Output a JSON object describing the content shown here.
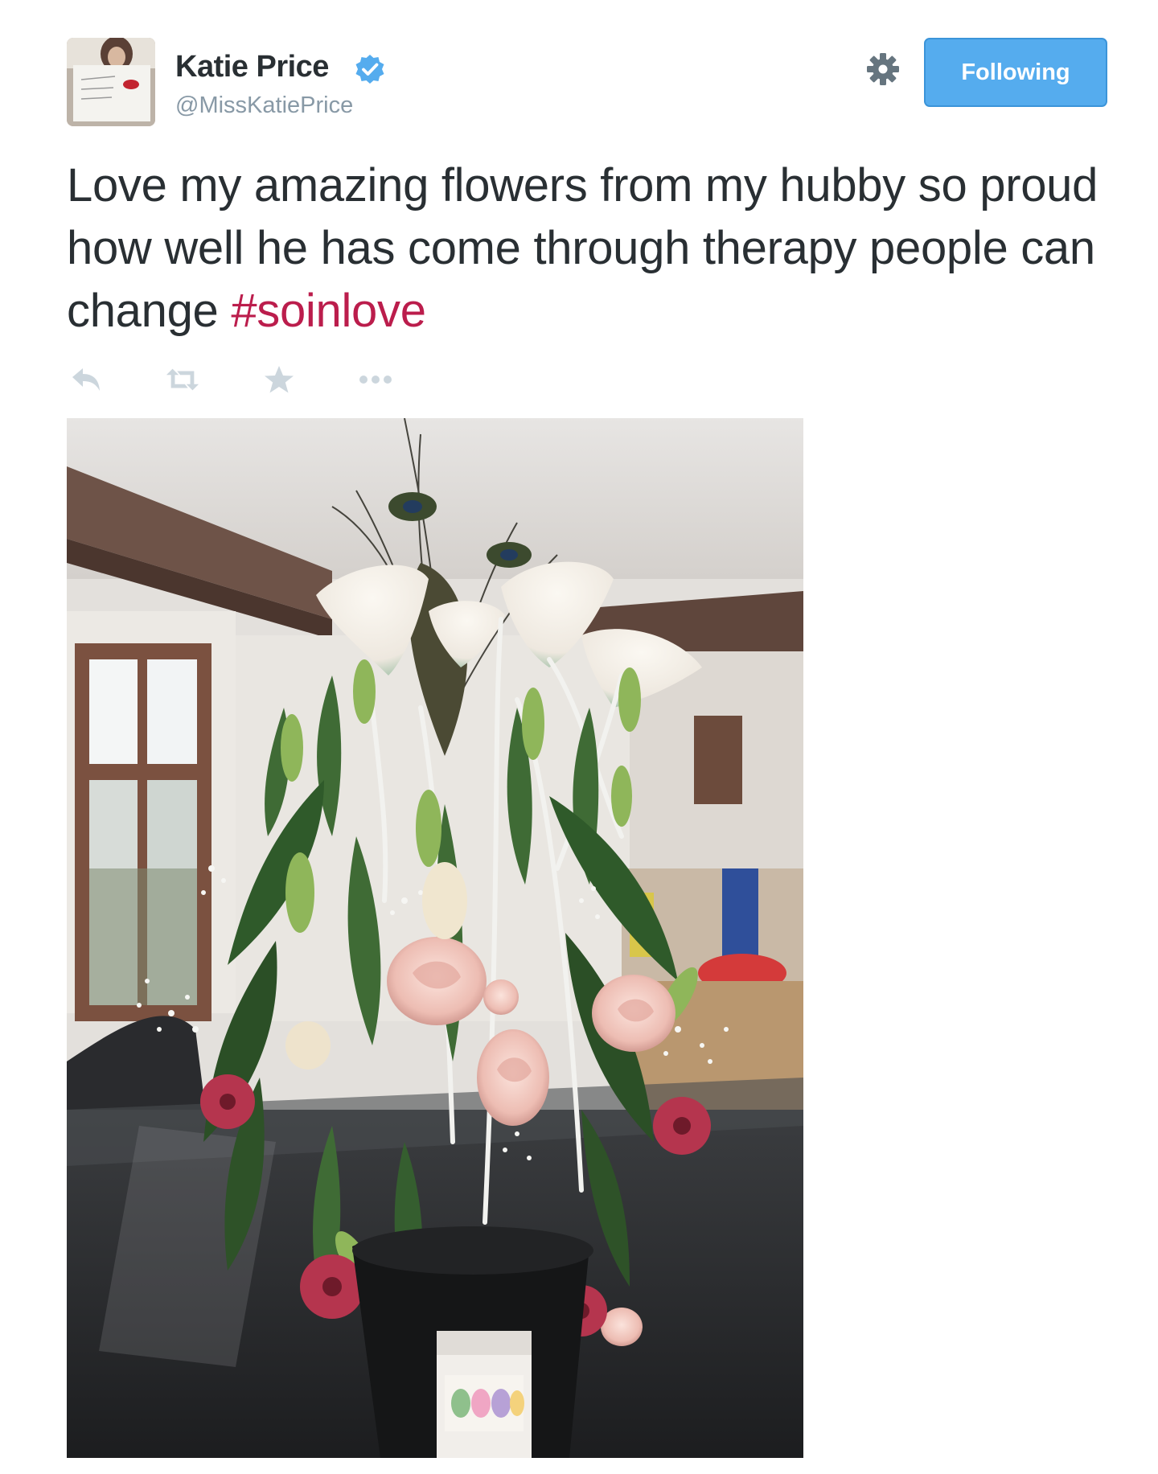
{
  "tweet": {
    "author": {
      "name": "Katie Price",
      "handle": "@MissKatiePrice",
      "verified": true,
      "avatar_icon": "profile-photo"
    },
    "follow_button_label": "Following",
    "settings_icon": "gear-icon",
    "text": "Love my amazing flowers from my hubby so proud how well he has come through therapy people can change ",
    "hashtag": "#soinlove",
    "actions": [
      {
        "name": "reply-icon"
      },
      {
        "name": "retweet-icon"
      },
      {
        "name": "favorite-icon"
      },
      {
        "name": "more-icon"
      }
    ],
    "media": {
      "type": "photo",
      "subject": "flower-bouquet"
    }
  },
  "colors": {
    "button_blue": "#55acee",
    "hashtag": "#bb1d4c",
    "handle_gray": "#8899a6",
    "text": "#292f33",
    "icon_gray": "#ccd6dd"
  }
}
